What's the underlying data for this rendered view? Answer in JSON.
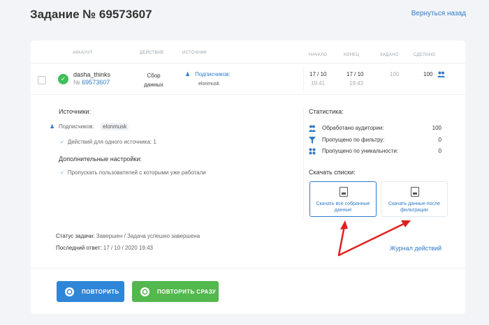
{
  "header": {
    "title": "Задание № 69573607",
    "back_label": "Вернуться назад"
  },
  "table": {
    "headers": {
      "account": "АККАУНТ",
      "action": "ДЕЙСТВИЕ",
      "source": "ИСТОЧНИК",
      "start": "НАЧАЛО",
      "end": "КОНЕЦ",
      "assigned": "ЗАДАНО",
      "done": "СДЕЛАНО"
    },
    "row": {
      "account_name": "dasha_thinks",
      "account_id_prefix": "№",
      "account_id": "69573607",
      "action_line1": "Сбор",
      "action_line2": "данных",
      "source_label": "Подписчиков:",
      "source_value": "elonmusk",
      "start_date": "17 / 10",
      "start_time": "19:41",
      "end_date": "17 / 10",
      "end_time": "19:43",
      "assigned": "100",
      "done": "100"
    }
  },
  "details": {
    "sources_title": "Источники:",
    "source_label": "Подписчиков:",
    "source_value": "elonmusk",
    "per_source": "Действий для одного источника: 1",
    "extra_title": "Дополнительные настройки:",
    "skip_users": "Пропускать пользователей с которыми уже работали"
  },
  "stats": {
    "title": "Статистика:",
    "rows": [
      {
        "label": "Обработано аудитории:",
        "value": "100"
      },
      {
        "label": "Пропущено по фильтру:",
        "value": "0"
      },
      {
        "label": "Пропущено по уникальности:",
        "value": "0"
      }
    ],
    "download_title": "Скачать списки:",
    "download_all": "Скачать все собранные данные",
    "download_filtered": "Скачать данные после фильтрации"
  },
  "status": {
    "label": "Статус задачи:",
    "value": "Завершен / Задача успешно завершена",
    "last_label": "Последний ответ:",
    "last_value": "17 / 10 / 2020 19:43",
    "journal": "Журнал действий"
  },
  "buttons": {
    "repeat": "ПОВТОРИТЬ",
    "repeat_now": "ПОВТОРИТЬ СРАЗУ"
  },
  "colors": {
    "accent": "#2f7bc9",
    "success": "#3fbf5a",
    "button_blue": "#2f86d8",
    "button_green": "#53b84d",
    "arrow": "#e02020"
  },
  "icons": {
    "ok": "check-circle-icon",
    "person": "user-icon",
    "people": "people-icon",
    "filter": "filter-icon",
    "unique": "grid-icon",
    "doc": "document-icon",
    "repeat": "refresh-icon"
  }
}
